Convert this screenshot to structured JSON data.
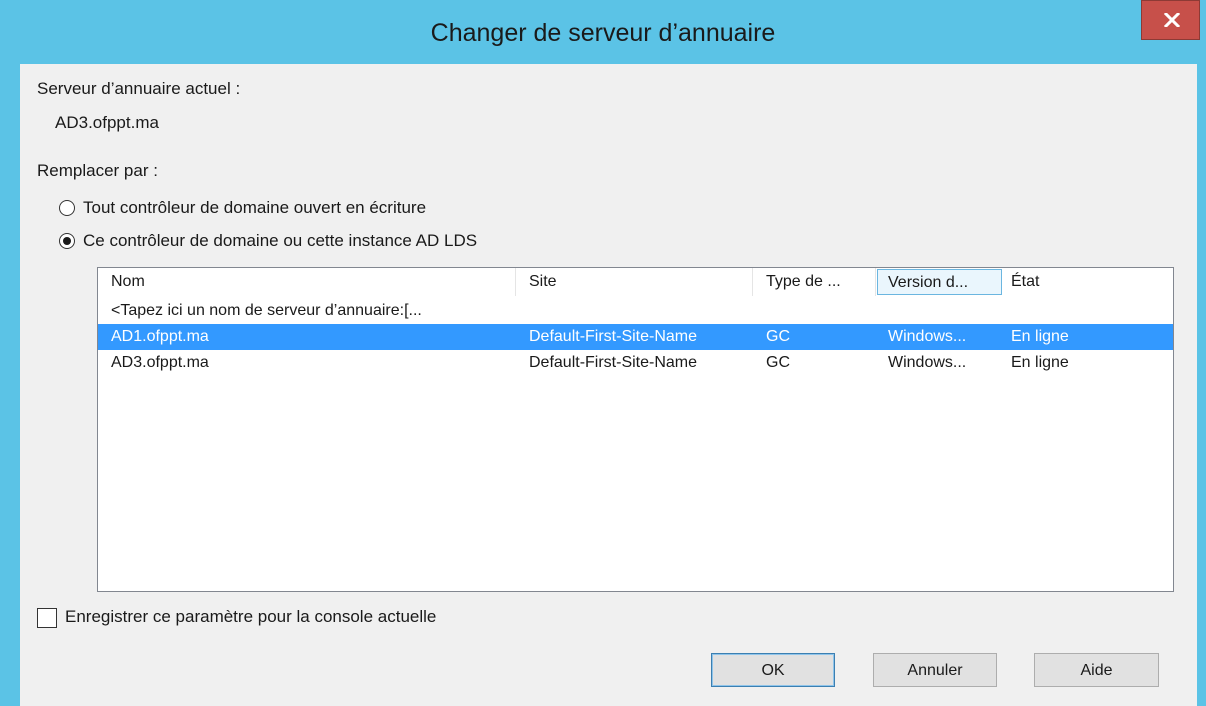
{
  "window": {
    "title": "Changer de serveur d’annuaire"
  },
  "current": {
    "label": "Serveur d’annuaire actuel :",
    "value": "AD3.ofppt.ma"
  },
  "replace": {
    "label": "Remplacer par :",
    "options": [
      {
        "label": "Tout contrôleur de domaine ouvert en écriture",
        "checked": false
      },
      {
        "label": "Ce contrôleur de domaine ou cette instance AD LDS",
        "checked": true
      }
    ]
  },
  "list": {
    "columns": [
      "Nom",
      "Site",
      "Type de ...",
      "Version d...",
      "État"
    ],
    "placeholder_row": "<Tapez ici un nom de serveur d’annuaire:[...",
    "rows": [
      {
        "name": "AD1.ofppt.ma",
        "site": "Default-First-Site-Name",
        "type": "GC",
        "version": "Windows...",
        "state": "En ligne",
        "selected": true
      },
      {
        "name": "AD3.ofppt.ma",
        "site": "Default-First-Site-Name",
        "type": "GC",
        "version": "Windows...",
        "state": "En ligne",
        "selected": false
      }
    ]
  },
  "save_setting": {
    "label": "Enregistrer ce paramètre pour la console actuelle",
    "checked": false
  },
  "buttons": {
    "ok": "OK",
    "cancel": "Annuler",
    "help": "Aide"
  },
  "colors": {
    "titlebar": "#5bc3e6",
    "close": "#c7504a",
    "selection": "#3399ff"
  },
  "icons": {
    "close": "close-icon"
  }
}
